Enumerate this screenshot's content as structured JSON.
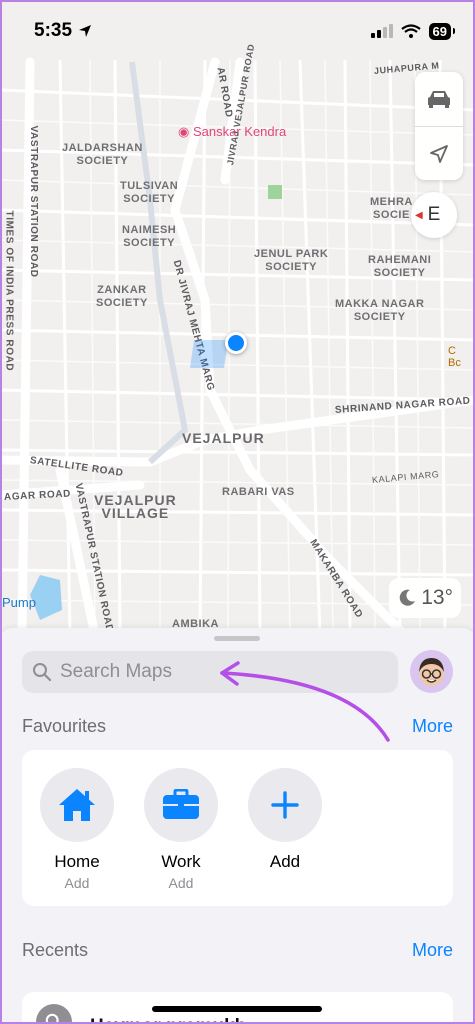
{
  "status_bar": {
    "time": "5:35",
    "battery": "69"
  },
  "map": {
    "areas": [
      "JALDARSHAN\nSOCIETY",
      "TULSIVAN\nSOCIETY",
      "NAIMESH\nSOCIETY",
      "ZANKAR\nSOCIETY",
      "JENUL PARK\nSOCIETY",
      "MAKKA NAGAR\nSOCIETY",
      "MEHRA\nSOCIE",
      "RAHEMANI\nSOCIETY",
      "VEJALPUR",
      "VEJALPUR\nVILLAGE",
      "RABARI VAS",
      "AMBIKA"
    ],
    "roads": [
      "VASTRAPUR STATION ROAD",
      "TIMES OF INDIA PRESS ROAD",
      "JIVRAJ VEJALPUR ROAD",
      "DR JIVRAJ MEHTA MARG",
      "SATELLITE ROAD",
      "AGAR ROAD",
      "VASTRAPUR STATION ROAD",
      "SHRINAND NAGAR ROAD",
      "KALAPI MARG",
      "MAKARBA ROAD",
      "JUHAPURA M",
      "AR ROAD",
      "JIVRAJ VEJALPUR ROAD"
    ],
    "poi": "Sanskar Kendra",
    "poi_right": "C\nBc",
    "pump_label": "Pump",
    "compass_letter": "E",
    "temperature": "13°"
  },
  "sheet": {
    "search_placeholder": "Search Maps",
    "favourites_title": "Favourites",
    "favourites_more": "More",
    "favourites": [
      {
        "label": "Home",
        "sub": "Add",
        "icon": "house-icon"
      },
      {
        "label": "Work",
        "sub": "Add",
        "icon": "briefcase-icon"
      },
      {
        "label": "Add",
        "sub": "",
        "icon": "plus-icon"
      }
    ],
    "recents_title": "Recents",
    "recents_more": "More",
    "recent_item": "Haymor pramukh"
  },
  "colors": {
    "accent": "#0a84ff",
    "annotation_arrow": "#b44fe8",
    "frame": "#b980e6"
  }
}
